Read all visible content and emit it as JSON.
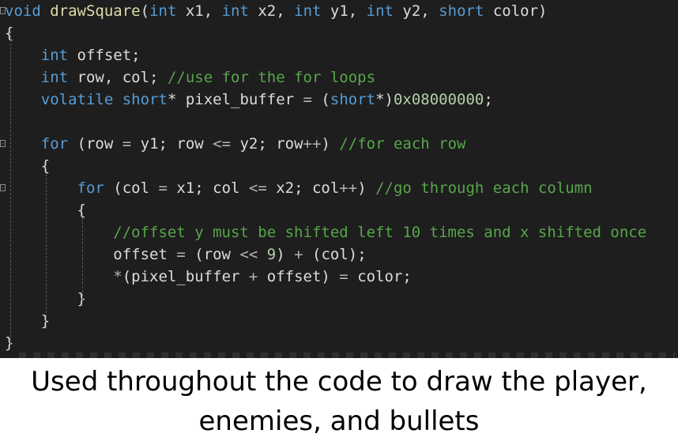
{
  "code_lines": [
    [
      {
        "t": "void",
        "c": "kw"
      },
      {
        "t": " ",
        "c": "pn"
      },
      {
        "t": "drawSquare",
        "c": "fn"
      },
      {
        "t": "(",
        "c": "pn"
      },
      {
        "t": "int",
        "c": "ty"
      },
      {
        "t": " x1, ",
        "c": "id"
      },
      {
        "t": "int",
        "c": "ty"
      },
      {
        "t": " x2, ",
        "c": "id"
      },
      {
        "t": "int",
        "c": "ty"
      },
      {
        "t": " y1, ",
        "c": "id"
      },
      {
        "t": "int",
        "c": "ty"
      },
      {
        "t": " y2, ",
        "c": "id"
      },
      {
        "t": "short",
        "c": "ty"
      },
      {
        "t": " color)",
        "c": "id"
      }
    ],
    [
      {
        "t": "{",
        "c": "pn"
      }
    ],
    [
      {
        "t": "    ",
        "c": "pn"
      },
      {
        "t": "int",
        "c": "ty"
      },
      {
        "t": " offset;",
        "c": "id"
      }
    ],
    [
      {
        "t": "    ",
        "c": "pn"
      },
      {
        "t": "int",
        "c": "ty"
      },
      {
        "t": " row, col; ",
        "c": "id"
      },
      {
        "t": "//use for the for loops",
        "c": "cm"
      }
    ],
    [
      {
        "t": "    ",
        "c": "pn"
      },
      {
        "t": "volatile",
        "c": "kw"
      },
      {
        "t": " ",
        "c": "pn"
      },
      {
        "t": "short",
        "c": "ty"
      },
      {
        "t": "* pixel_buffer ",
        "c": "id"
      },
      {
        "t": "=",
        "c": "op"
      },
      {
        "t": " (",
        "c": "pn"
      },
      {
        "t": "short",
        "c": "ty"
      },
      {
        "t": "*)",
        "c": "pn"
      },
      {
        "t": "0x08000000",
        "c": "nm"
      },
      {
        "t": ";",
        "c": "pn"
      }
    ],
    [],
    [
      {
        "t": "    ",
        "c": "pn"
      },
      {
        "t": "for",
        "c": "kw"
      },
      {
        "t": " (row ",
        "c": "id"
      },
      {
        "t": "=",
        "c": "op"
      },
      {
        "t": " y1; row ",
        "c": "id"
      },
      {
        "t": "<=",
        "c": "op"
      },
      {
        "t": " y2; row",
        "c": "id"
      },
      {
        "t": "++",
        "c": "op"
      },
      {
        "t": ") ",
        "c": "pn"
      },
      {
        "t": "//for each row",
        "c": "cm"
      }
    ],
    [
      {
        "t": "    {",
        "c": "pn"
      }
    ],
    [
      {
        "t": "        ",
        "c": "pn"
      },
      {
        "t": "for",
        "c": "kw"
      },
      {
        "t": " (col ",
        "c": "id"
      },
      {
        "t": "=",
        "c": "op"
      },
      {
        "t": " x1; col ",
        "c": "id"
      },
      {
        "t": "<=",
        "c": "op"
      },
      {
        "t": " x2; col",
        "c": "id"
      },
      {
        "t": "++",
        "c": "op"
      },
      {
        "t": ") ",
        "c": "pn"
      },
      {
        "t": "//go through each column",
        "c": "cm"
      }
    ],
    [
      {
        "t": "        {",
        "c": "pn"
      }
    ],
    [
      {
        "t": "            ",
        "c": "pn"
      },
      {
        "t": "//offset y must be shifted left 10 times and x shifted once",
        "c": "cm"
      }
    ],
    [
      {
        "t": "            offset ",
        "c": "id"
      },
      {
        "t": "=",
        "c": "op"
      },
      {
        "t": " (row ",
        "c": "id"
      },
      {
        "t": "<<",
        "c": "op"
      },
      {
        "t": " ",
        "c": "pn"
      },
      {
        "t": "9",
        "c": "nm"
      },
      {
        "t": ") ",
        "c": "pn"
      },
      {
        "t": "+",
        "c": "op"
      },
      {
        "t": " (col);",
        "c": "id"
      }
    ],
    [
      {
        "t": "            ",
        "c": "pn"
      },
      {
        "t": "*",
        "c": "op"
      },
      {
        "t": "(pixel_buffer ",
        "c": "id"
      },
      {
        "t": "+",
        "c": "op"
      },
      {
        "t": " offset) ",
        "c": "id"
      },
      {
        "t": "=",
        "c": "op"
      },
      {
        "t": " color;",
        "c": "id"
      }
    ],
    [
      {
        "t": "        }",
        "c": "pn"
      }
    ],
    [
      {
        "t": "    }",
        "c": "pn"
      }
    ],
    [
      {
        "t": "}",
        "c": "pn"
      }
    ]
  ],
  "fold_markers": [
    "-",
    "-",
    "-"
  ],
  "caption": {
    "line1": "Used throughout the code to draw the player,",
    "line2": "enemies, and bullets"
  },
  "colors": {
    "editor_background": "#1e1e1e",
    "keyword": "#569cd6",
    "function": "#dcdcaa",
    "comment": "#57a64a",
    "number": "#b5cea8",
    "text": "#dcdcdc"
  }
}
